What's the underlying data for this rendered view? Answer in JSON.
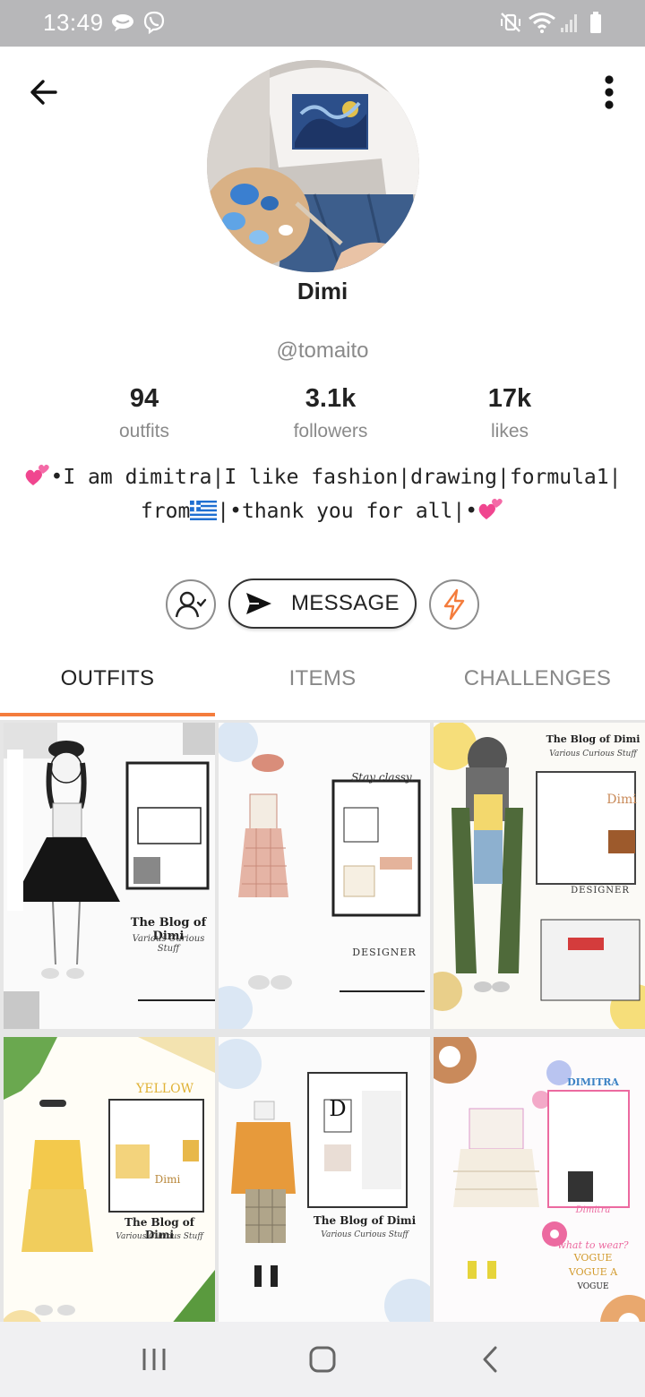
{
  "status_bar": {
    "time": "13:49",
    "icons": [
      "chat-bubble-icon",
      "viber-icon",
      "mute-vibrate-icon",
      "wifi-icon",
      "signal-icon",
      "battery-icon"
    ]
  },
  "header": {
    "back_icon": "arrow-left-icon",
    "menu_icon": "more-vertical-icon"
  },
  "profile": {
    "display_name": "Dimi",
    "username": "@tomaito",
    "stats": [
      {
        "value": "94",
        "label": "outfits"
      },
      {
        "value": "3.1k",
        "label": "followers"
      },
      {
        "value": "17k",
        "label": "likes"
      }
    ],
    "bio_line1": "•I am dimitra|I like fashion|drawing|formula1|",
    "bio_line2_a": "from",
    "bio_line2_b": "|•thank you for all|•"
  },
  "actions": {
    "follow_icon": "user-check-icon",
    "message_label": "MESSAGE",
    "message_icon": "send-icon",
    "boost_icon": "lightning-icon"
  },
  "tabs": [
    {
      "label": "OUTFITS",
      "active": true
    },
    {
      "label": "ITEMS",
      "active": false
    },
    {
      "label": "CHALLENGES",
      "active": false
    }
  ],
  "tiles": [
    {
      "texts": [
        "The Blog of Dimi",
        "Various Curious Stuff"
      ],
      "accent": "#1e1e1e"
    },
    {
      "texts": [
        "Stay classy.",
        "DESIGNER"
      ],
      "accent": "#d98d7a"
    },
    {
      "texts": [
        "The Blog of Dimi",
        "Various Curious Stuff",
        "Dimi",
        "DESIGNER"
      ],
      "accent": "#4f6a3a"
    },
    {
      "texts": [
        "YELLOW",
        "The Blog of Dimi",
        "Various Curious Stuff",
        "Dimi"
      ],
      "accent": "#f3c94c"
    },
    {
      "texts": [
        "D",
        "The Blog of Dimi",
        "Various Curious Stuff"
      ],
      "accent": "#e79a3b"
    },
    {
      "texts": [
        "DIMITRA",
        "Dimitra",
        "what to wear?",
        "VOGUE",
        "VOGUE A",
        "VOGUE"
      ],
      "accent": "#ec6aa0"
    }
  ],
  "nav": {
    "recents_icon": "recent-apps-icon",
    "home_icon": "home-icon",
    "back_icon": "nav-back-icon"
  },
  "colors": {
    "accent_orange": "#f47c3c",
    "status_bar": "#b7b7b9",
    "muted_text": "#8a8a8a"
  }
}
